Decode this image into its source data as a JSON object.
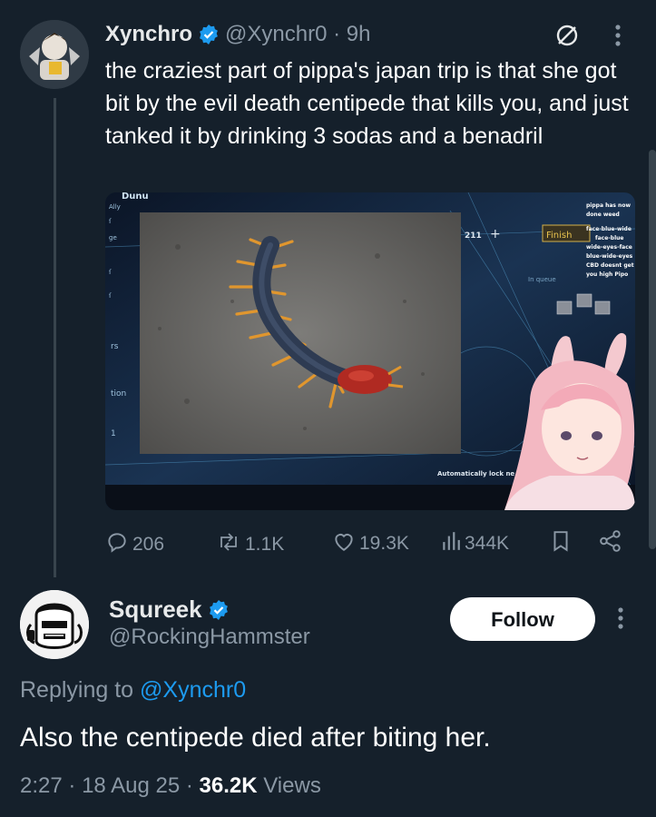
{
  "tweet1": {
    "author_name": "Xynchro",
    "handle": "@Xynchr0",
    "time": "9h",
    "text": "the craziest part of pippa's japan trip is that she got bit by the evil death centipede that kills you, and just tanked it by drinking 3 sodas and a benadril",
    "media": {
      "game_ui": {
        "counter": "211",
        "finish_label": "Finish",
        "queue_label": "In queue",
        "auto_lock": "Automatically lock ne",
        "top_left": "Dunu",
        "side_text": [
          "tion",
          "rs",
          "1"
        ],
        "chat_lines": [
          "pippa has now",
          "done weed",
          "face-blue-wide",
          "face-blue",
          "wide-eyes-face",
          "blue-wide-eyes",
          "CBD doesnt get",
          "you high Pipo"
        ]
      }
    },
    "actions": {
      "replies": "206",
      "reposts": "1.1K",
      "likes": "19.3K",
      "views": "344K"
    }
  },
  "tweet2": {
    "author_name": "Squreek",
    "handle": "@RockingHammster",
    "follow_label": "Follow",
    "replying_prefix": "Replying to",
    "replying_mention": "@Xynchr0",
    "text": "Also the centipede died after biting her.",
    "time": "2:27",
    "date": "18 Aug 25",
    "views_count": "36.2K",
    "views_label": "Views"
  },
  "colors": {
    "background": "#15202b",
    "verified": "#1d9bf0",
    "muted": "#8b98a5",
    "accent_link": "#1d9bf0"
  },
  "icons": [
    "verified-icon",
    "no-audio-icon",
    "more-icon",
    "reply-icon",
    "repost-icon",
    "like-icon",
    "views-icon",
    "bookmark-icon",
    "share-icon"
  ]
}
